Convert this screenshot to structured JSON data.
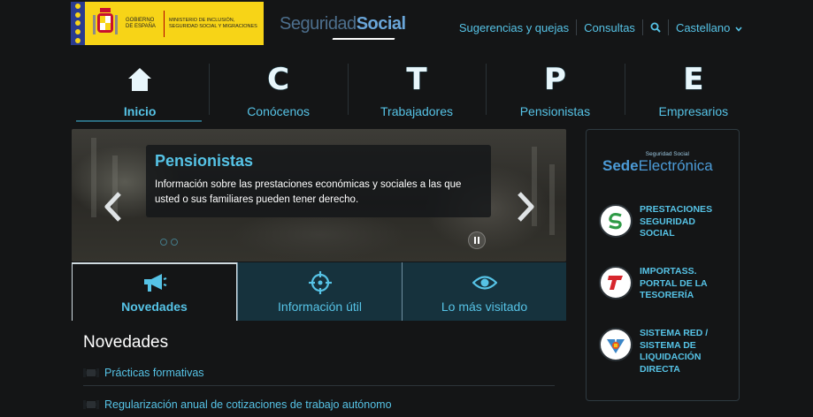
{
  "header": {
    "gov_text": "Gobierno de España",
    "ministry_text": "Ministerio de Inclusión, Seguridad Social y Migraciones",
    "logo_part1": "Seguridad",
    "logo_part2": "Social",
    "links": [
      "Sugerencias y quejas",
      "Consultas"
    ],
    "language": "Castellano"
  },
  "nav": [
    {
      "label": "Inicio",
      "icon": "home-icon",
      "active": true
    },
    {
      "label": "Conócenos",
      "icon": "letter-c-icon",
      "letter": "C"
    },
    {
      "label": "Trabajadores",
      "icon": "letter-t-icon",
      "letter": "T"
    },
    {
      "label": "Pensionistas",
      "icon": "letter-p-icon",
      "letter": "P"
    },
    {
      "label": "Empresarios",
      "icon": "letter-e-icon",
      "letter": "E"
    }
  ],
  "carousel": {
    "title": "Pensionistas",
    "text": "Información sobre las prestaciones económicas y sociales a las que usted o sus familiares pueden tener derecho."
  },
  "tabs": [
    {
      "label": "Novedades",
      "icon": "megaphone-icon",
      "active": true
    },
    {
      "label": "Información útil",
      "icon": "crosshair-icon"
    },
    {
      "label": "Lo más visitado",
      "icon": "eye-icon"
    }
  ],
  "news": {
    "heading": "Novedades",
    "items": [
      "Prácticas formativas",
      "Regularización anual de cotizaciones de trabajo autónomo"
    ]
  },
  "sidebar": {
    "sede_small": "Seguridad Social",
    "sede_part1": "Sede",
    "sede_part2": "Electrónica",
    "items": [
      {
        "label": "PRESTACIONES SEGURIDAD SOCIAL",
        "icon": "prestaciones-logo-icon"
      },
      {
        "label": "IMPORTASS. PORTAL DE LA TESORERÍA",
        "icon": "importass-logo-icon"
      },
      {
        "label": "SISTEMA RED / SISTEMA DE LIQUIDACIÓN DIRECTA",
        "icon": "sistema-red-logo-icon"
      }
    ]
  },
  "colors": {
    "accent": "#56c3e6",
    "background": "#141516",
    "tab_bg": "#16323d"
  }
}
